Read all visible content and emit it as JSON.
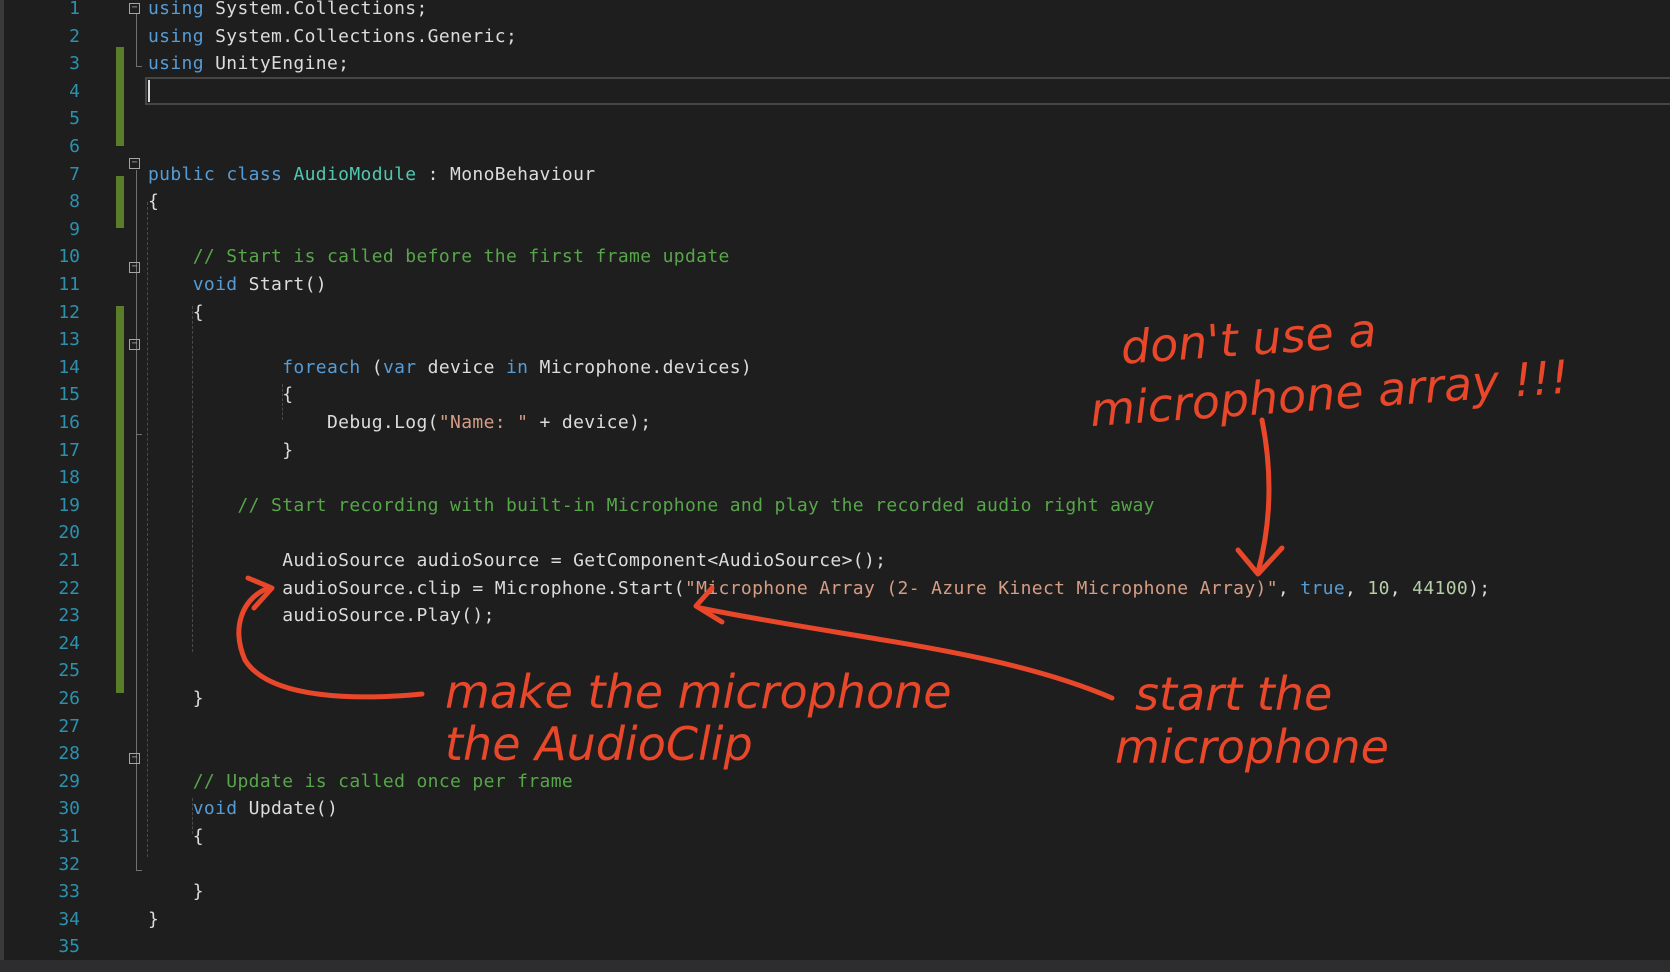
{
  "editor": {
    "lines": [
      {
        "n": "1",
        "tokens": [
          {
            "t": "using",
            "c": "kw"
          },
          {
            "t": " System.Collections;"
          }
        ]
      },
      {
        "n": "2",
        "tokens": [
          {
            "t": "using",
            "c": "kw"
          },
          {
            "t": " System.Collections.Generic;"
          }
        ]
      },
      {
        "n": "3",
        "tokens": [
          {
            "t": "using",
            "c": "kw"
          },
          {
            "t": " UnityEngine;"
          }
        ]
      },
      {
        "n": "4",
        "tokens": []
      },
      {
        "n": "5",
        "tokens": []
      },
      {
        "n": "6",
        "tokens": []
      },
      {
        "n": "7",
        "tokens": [
          {
            "t": "public",
            "c": "kw"
          },
          {
            "t": " "
          },
          {
            "t": "class",
            "c": "kw"
          },
          {
            "t": " "
          },
          {
            "t": "AudioModule",
            "c": "ty"
          },
          {
            "t": " : MonoBehaviour"
          }
        ]
      },
      {
        "n": "8",
        "tokens": [
          {
            "t": "{"
          }
        ]
      },
      {
        "n": "9",
        "tokens": []
      },
      {
        "n": "10",
        "tokens": [
          {
            "t": "    "
          },
          {
            "t": "// Start is called before the first frame update",
            "c": "cm"
          }
        ]
      },
      {
        "n": "11",
        "tokens": [
          {
            "t": "    "
          },
          {
            "t": "void",
            "c": "kw"
          },
          {
            "t": " Start()"
          }
        ]
      },
      {
        "n": "12",
        "tokens": [
          {
            "t": "    {"
          }
        ]
      },
      {
        "n": "13",
        "tokens": []
      },
      {
        "n": "14",
        "tokens": [
          {
            "t": "            "
          },
          {
            "t": "foreach",
            "c": "kw"
          },
          {
            "t": " ("
          },
          {
            "t": "var",
            "c": "kw"
          },
          {
            "t": " device "
          },
          {
            "t": "in",
            "c": "kw"
          },
          {
            "t": " Microphone.devices)"
          }
        ]
      },
      {
        "n": "15",
        "tokens": [
          {
            "t": "            {"
          }
        ]
      },
      {
        "n": "16",
        "tokens": [
          {
            "t": "                Debug.Log("
          },
          {
            "t": "\"Name: \"",
            "c": "st"
          },
          {
            "t": " + device);"
          }
        ]
      },
      {
        "n": "17",
        "tokens": [
          {
            "t": "            }"
          }
        ]
      },
      {
        "n": "18",
        "tokens": []
      },
      {
        "n": "19",
        "tokens": [
          {
            "t": "        "
          },
          {
            "t": "// Start recording with built-in Microphone and play the recorded audio right away",
            "c": "cm"
          }
        ]
      },
      {
        "n": "20",
        "tokens": []
      },
      {
        "n": "21",
        "tokens": [
          {
            "t": "            AudioSource audioSource = GetComponent<AudioSource>();"
          }
        ]
      },
      {
        "n": "22",
        "tokens": [
          {
            "t": "            audioSource.clip = Microphone.Start("
          },
          {
            "t": "\"Microphone Array (2- Azure Kinect Microphone Array)\"",
            "c": "st"
          },
          {
            "t": ", "
          },
          {
            "t": "true",
            "c": "kw"
          },
          {
            "t": ", "
          },
          {
            "t": "10",
            "c": "nm"
          },
          {
            "t": ", "
          },
          {
            "t": "44100",
            "c": "nm"
          },
          {
            "t": ");"
          }
        ]
      },
      {
        "n": "23",
        "tokens": [
          {
            "t": "            audioSource.Play();"
          }
        ]
      },
      {
        "n": "24",
        "tokens": []
      },
      {
        "n": "25",
        "tokens": []
      },
      {
        "n": "26",
        "tokens": [
          {
            "t": "    }"
          }
        ]
      },
      {
        "n": "27",
        "tokens": []
      },
      {
        "n": "28",
        "tokens": []
      },
      {
        "n": "29",
        "tokens": [
          {
            "t": "    "
          },
          {
            "t": "// Update is called once per frame",
            "c": "cm"
          }
        ]
      },
      {
        "n": "30",
        "tokens": [
          {
            "t": "    "
          },
          {
            "t": "void",
            "c": "kw"
          },
          {
            "t": " Update()"
          }
        ]
      },
      {
        "n": "31",
        "tokens": [
          {
            "t": "    {"
          }
        ]
      },
      {
        "n": "32",
        "tokens": []
      },
      {
        "n": "33",
        "tokens": [
          {
            "t": "    }"
          }
        ]
      },
      {
        "n": "34",
        "tokens": [
          {
            "t": "}"
          }
        ]
      },
      {
        "n": "35",
        "tokens": []
      }
    ],
    "fold_toggle_glyph": "−"
  },
  "annotations": {
    "note_array_line1": "don't use a",
    "note_array_line2": "microphone array !!!",
    "note_clip_line1": "make the microphone",
    "note_clip_line2": "the AudioClip",
    "note_start_line1": "start the",
    "note_start_line2": "microphone"
  },
  "colors": {
    "background": "#1e1e1e",
    "line_number": "#2b91af",
    "keyword": "#569cd6",
    "type": "#4ec9b0",
    "comment": "#57a64a",
    "string": "#d69d85",
    "number": "#b5cea8",
    "change_bar": "#5a7d2a",
    "annotation_ink": "#e8472a"
  }
}
